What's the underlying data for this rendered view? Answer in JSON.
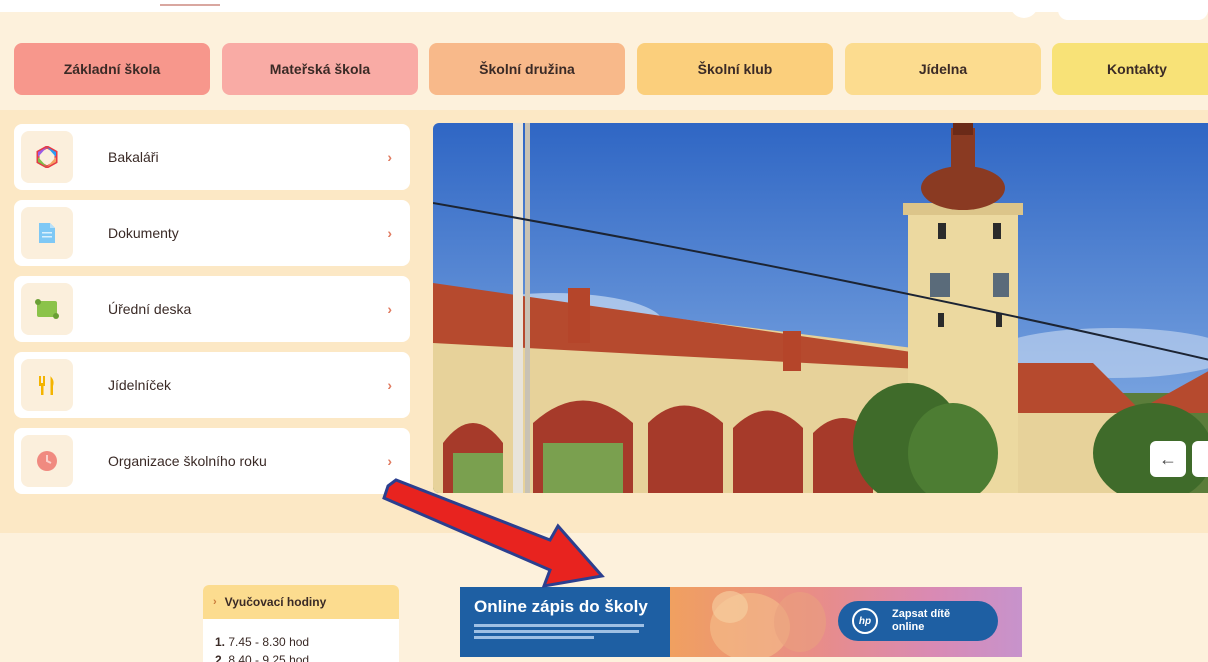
{
  "nav": {
    "items": [
      "Základní škola",
      "Mateřská škola",
      "Školní družina",
      "Školní klub",
      "Jídelna",
      "Kontakty"
    ]
  },
  "quicklinks": [
    {
      "label": "Bakaláři",
      "icon": "bakalari-logo-icon"
    },
    {
      "label": "Dokumenty",
      "icon": "document-icon"
    },
    {
      "label": "Úřední deska",
      "icon": "scroll-icon"
    },
    {
      "label": "Jídelníček",
      "icon": "cutlery-icon"
    },
    {
      "label": "Organizace školního roku",
      "icon": "clock-icon"
    }
  ],
  "slider": {
    "prev_label": "←",
    "next_label": "→"
  },
  "hours": {
    "title": "Vyučovací hodiny",
    "lines": [
      {
        "num": "1.",
        "text": "7.45 - 8.30 hod"
      },
      {
        "num": "2.",
        "text": "8.40 - 9.25 hod"
      }
    ]
  },
  "banner": {
    "title": "Online zápis do školy",
    "cta": "Zapsat dítě online",
    "cta_logo": "hp"
  },
  "colors": {
    "background": "#fdf1dc",
    "accent_chevron": "#e07a5f",
    "banner_blue": "#1e5fa3",
    "annotation_arrow": "#e8231f"
  }
}
